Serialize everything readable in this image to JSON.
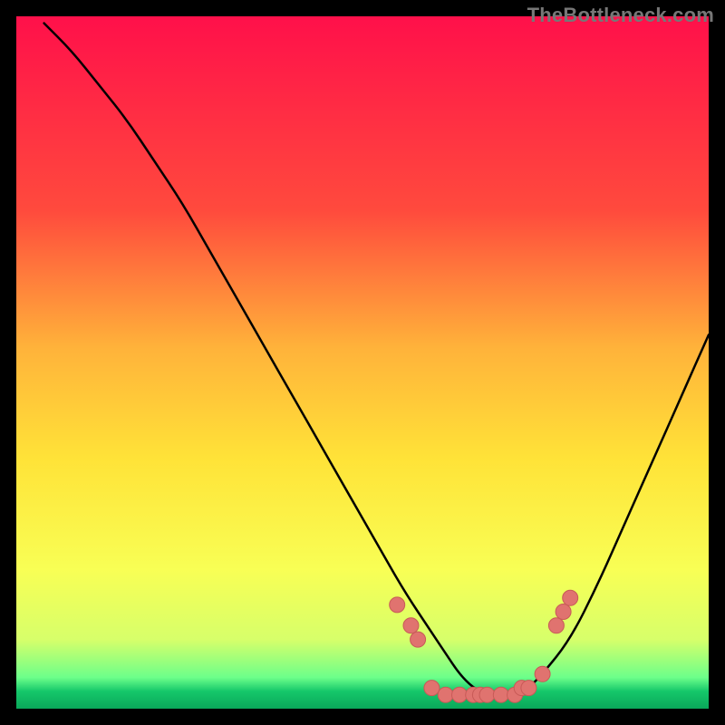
{
  "watermark": "TheBottleneck.com",
  "colors": {
    "black": "#000000",
    "gradient_top": "#ff104a",
    "gradient_mid_upper": "#ff7a3a",
    "gradient_mid": "#ffe338",
    "gradient_low": "#f2ff66",
    "gradient_bottom": "#15c76a",
    "curve": "#000000",
    "marker_fill": "#e0736f",
    "marker_stroke": "#c85a57"
  },
  "chart_data": {
    "type": "line",
    "title": "",
    "xlabel": "",
    "ylabel": "",
    "xlim": [
      0,
      100
    ],
    "ylim": [
      0,
      100
    ],
    "series": [
      {
        "name": "bottleneck-curve",
        "x": [
          4,
          8,
          12,
          16,
          20,
          24,
          28,
          32,
          36,
          40,
          44,
          48,
          52,
          56,
          60,
          62,
          64,
          66,
          68,
          70,
          72,
          74,
          76,
          80,
          84,
          88,
          92,
          96,
          100
        ],
        "y": [
          99,
          95,
          90,
          85,
          79,
          73,
          66,
          59,
          52,
          45,
          38,
          31,
          24,
          17,
          11,
          8,
          5,
          3,
          2,
          2,
          2,
          3,
          5,
          10,
          18,
          27,
          36,
          45,
          54
        ]
      }
    ],
    "markers": {
      "name": "highlighted-points",
      "points": [
        {
          "x": 55,
          "y": 15
        },
        {
          "x": 57,
          "y": 12
        },
        {
          "x": 58,
          "y": 10
        },
        {
          "x": 60,
          "y": 3
        },
        {
          "x": 62,
          "y": 2
        },
        {
          "x": 64,
          "y": 2
        },
        {
          "x": 66,
          "y": 2
        },
        {
          "x": 67,
          "y": 2
        },
        {
          "x": 68,
          "y": 2
        },
        {
          "x": 70,
          "y": 2
        },
        {
          "x": 72,
          "y": 2
        },
        {
          "x": 73,
          "y": 3
        },
        {
          "x": 74,
          "y": 3
        },
        {
          "x": 76,
          "y": 5
        },
        {
          "x": 78,
          "y": 12
        },
        {
          "x": 79,
          "y": 14
        },
        {
          "x": 80,
          "y": 16
        }
      ]
    }
  }
}
